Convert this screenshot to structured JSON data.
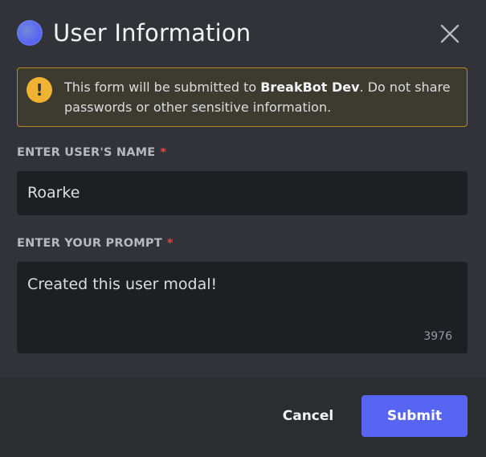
{
  "modal": {
    "title": "User Information",
    "close_icon": "close-icon"
  },
  "notice": {
    "icon": "warning-icon",
    "text_before": "This form will be submitted to ",
    "bot_name": "BreakBot Dev",
    "text_after": ". Do not share passwords or other sensitive information.",
    "accent_color": "#f0b232"
  },
  "fields": {
    "name": {
      "label": "ENTER USER'S NAME",
      "required_mark": "*",
      "value": "Roarke"
    },
    "prompt": {
      "label": "ENTER YOUR PROMPT",
      "required_mark": "*",
      "value": "Created this user modal!",
      "remaining_chars": "3976"
    }
  },
  "footer": {
    "cancel_label": "Cancel",
    "submit_label": "Submit",
    "submit_color": "#5865f2"
  }
}
